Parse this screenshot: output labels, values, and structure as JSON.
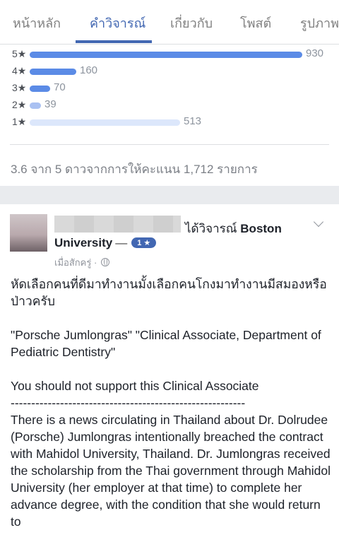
{
  "tabs": [
    {
      "label": "หน้าหลัก"
    },
    {
      "label": "คำวิจารณ์"
    },
    {
      "label": "เกี่ยวกับ"
    },
    {
      "label": "โพสต์"
    },
    {
      "label": "รูปภาพ"
    }
  ],
  "active_tab": "คำวิจารณ์",
  "ratings": [
    {
      "stars": "5★",
      "count": "930",
      "value": 930
    },
    {
      "stars": "4★",
      "count": "160",
      "value": 160
    },
    {
      "stars": "3★",
      "count": "70",
      "value": 70
    },
    {
      "stars": "2★",
      "count": "39",
      "value": 39
    },
    {
      "stars": "1★",
      "count": "513",
      "value": 513
    }
  ],
  "summary": "3.6 จาก 5 ดาวจากการให้คะแนน 1,712 รายการ",
  "post": {
    "reviewed_text": "ได้วิจารณ์",
    "page_name_part1": "Boston",
    "page_name_part2": "University",
    "dash": "—",
    "rating_badge": "1 ★",
    "time": "เมื่อสักครู่",
    "separator": "·",
    "paragraphs": [
      "หัดเลือกคนที่ดีมาทำงานมั้งเลือกคนโกงมาทำงานมีสมองหรือป่าวครับ",
      "\"Porsche Jumlongras\" \"Clinical Associate, Department of Pediatric Dentistry\"",
      "You should not support this Clinical Associate",
      "---------------------------------------------------------",
      "There is a news circulating in Thailand about Dr. Dolrudee (Porsche) Jumlongras intentionally breached the contract with Mahidol University, Thailand. Dr. Jumlongras received the scholarship from the Thai government through Mahidol University (her employer at that time) to complete her advance degree, with the condition that she would return to"
    ]
  },
  "colors": {
    "accent": "#4267b2",
    "bar": "#5b8be6",
    "bar_faint": "#dce7fb",
    "page_bg_gap": "#e9ebee"
  }
}
